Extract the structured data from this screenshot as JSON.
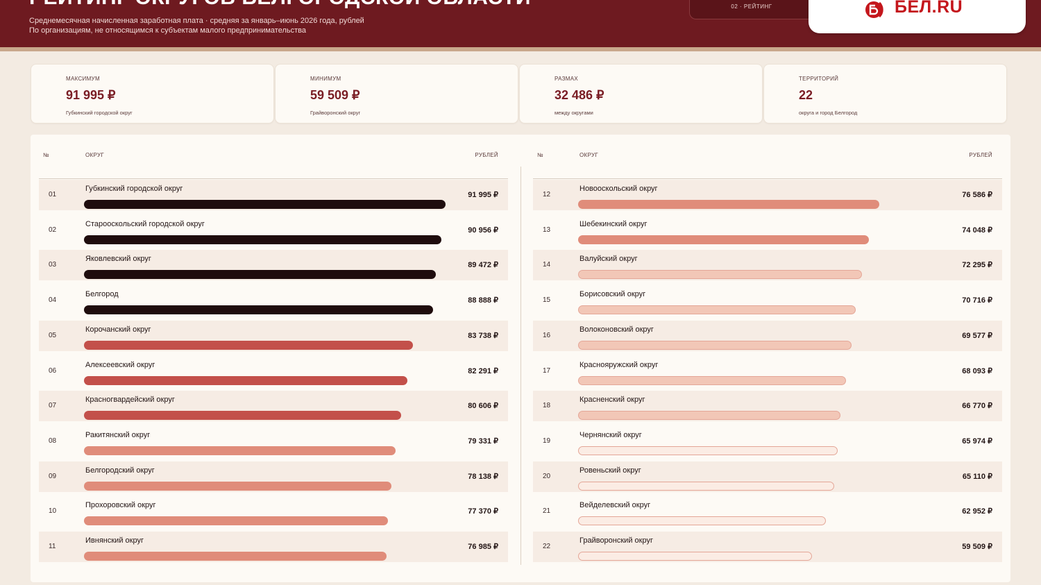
{
  "header": {
    "title": "РЕЙТИНГ ОКРУГОВ БЕЛГОРОДСКОЙ ОБЛАСТИ",
    "subtitle_line1": "Среднемесячная начисленная заработная плата  ·  средняя за январь–июнь 2026 года, рублей",
    "subtitle_line2": "По организациям, не относящимся к субъектам малого предпринимательства",
    "tab_label": "02  ·  РЕЙТИНГ",
    "logo_text": "БЕЛ.RU"
  },
  "stats": [
    {
      "label": "МАКСИМУМ",
      "value": "91 995 ₽",
      "note": "Губкинский городской округ"
    },
    {
      "label": "МИНИМУМ",
      "value": "59 509 ₽",
      "note": "Грайворонский округ"
    },
    {
      "label": "РАЗМАХ",
      "value": "32 486 ₽",
      "note": "между округами"
    },
    {
      "label": "ТЕРРИТОРИЙ",
      "value": "22",
      "note": "округа и город Белгород"
    }
  ],
  "table": {
    "head_num": "№",
    "head_name": "ОКРУГ",
    "head_value": "РУБЛЕЙ"
  },
  "colors": {
    "dark": "#1f0c0d",
    "red": "#c3504a",
    "salmon": "#e08c7a",
    "light": "#f2c7b7",
    "pale": "#fbece4",
    "pale_border": "#e4a697"
  },
  "chart_data": {
    "type": "bar",
    "categories": [
      "Губкинский городской округ",
      "Старооскольский городской округ",
      "Яковлевский округ",
      "Белгород",
      "Корочанский округ",
      "Алексеевский округ",
      "Красногвардейский округ",
      "Ракитянский округ",
      "Белгородский округ",
      "Прохоровский округ",
      "Ивнянский округ",
      "Новооскольский округ",
      "Шебекинский округ",
      "Валуйский округ",
      "Борисовский округ",
      "Волоконовский округ",
      "Краснояружский округ",
      "Красненский округ",
      "Чернянский округ",
      "Ровеньский округ",
      "Вейделевский округ",
      "Грайворонский округ"
    ],
    "ranks": [
      "01",
      "02",
      "03",
      "04",
      "05",
      "06",
      "07",
      "08",
      "09",
      "10",
      "11",
      "12",
      "13",
      "14",
      "15",
      "16",
      "17",
      "18",
      "19",
      "20",
      "21",
      "22"
    ],
    "values": [
      91995,
      90956,
      89472,
      88888,
      83738,
      82291,
      80606,
      79331,
      78138,
      77370,
      76985,
      76586,
      74048,
      72295,
      70716,
      69577,
      68093,
      66770,
      65974,
      65110,
      62952,
      59509
    ],
    "labels": [
      "91 995 ₽",
      "90 956 ₽",
      "89 472 ₽",
      "88 888 ₽",
      "83 738 ₽",
      "82 291 ₽",
      "80 606 ₽",
      "79 331 ₽",
      "78 138 ₽",
      "77 370 ₽",
      "76 985 ₽",
      "76 586 ₽",
      "74 048 ₽",
      "72 295 ₽",
      "70 716 ₽",
      "69 577 ₽",
      "68 093 ₽",
      "66 770 ₽",
      "65 974 ₽",
      "65 110 ₽",
      "62 952 ₽",
      "59 509 ₽"
    ],
    "tiers": [
      "dark",
      "dark",
      "dark",
      "dark",
      "red",
      "red",
      "red",
      "salmon",
      "salmon",
      "salmon",
      "salmon",
      "salmon",
      "salmon",
      "light",
      "light",
      "light",
      "light",
      "light",
      "pale",
      "pale",
      "pale",
      "pale"
    ]
  }
}
